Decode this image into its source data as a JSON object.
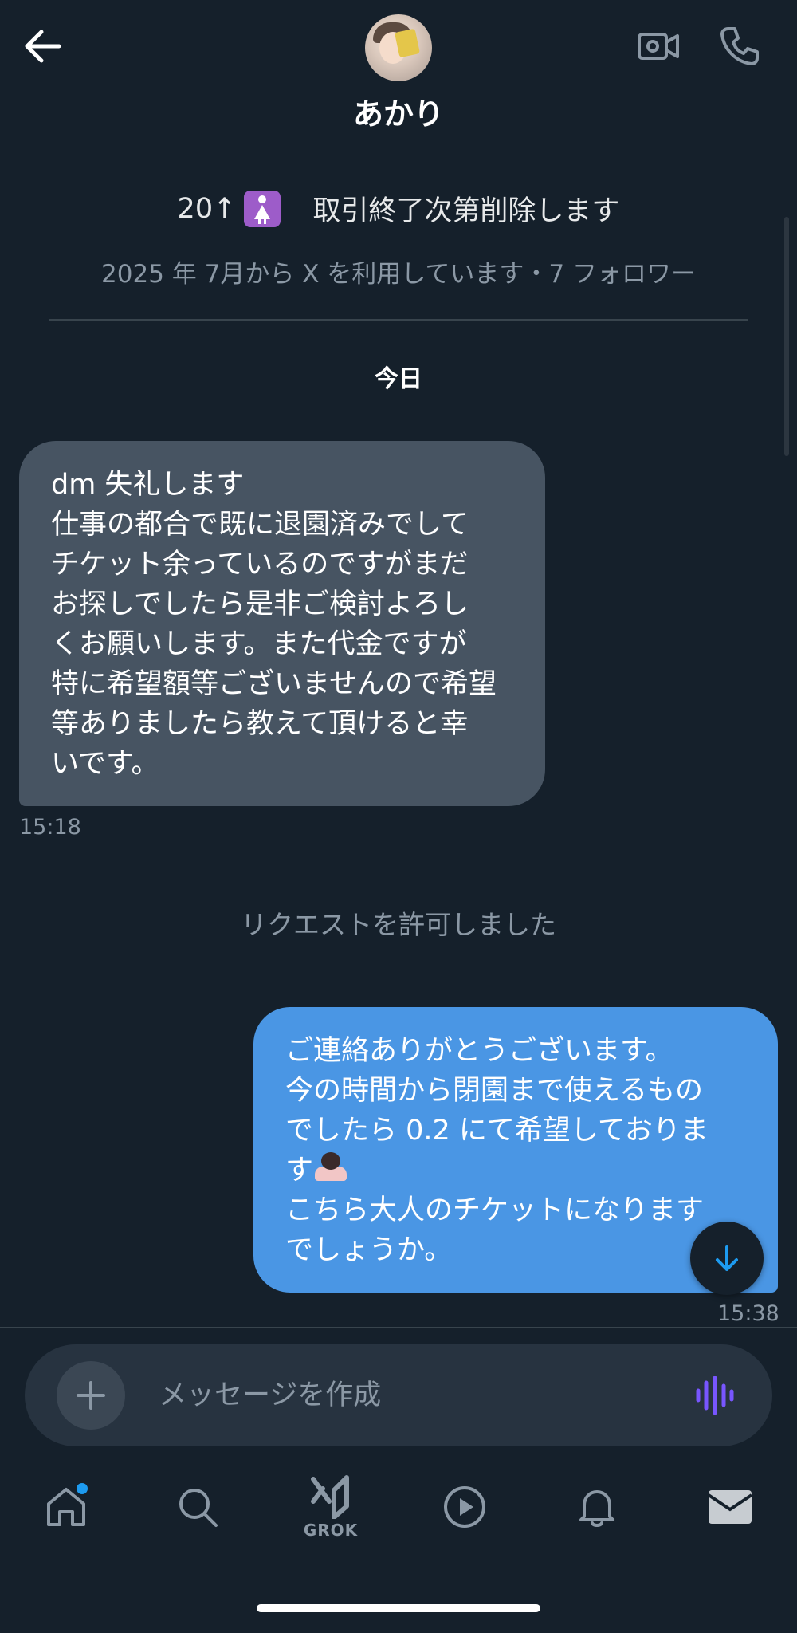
{
  "header": {
    "display_name": "あかり",
    "back_icon": "arrow-left-icon",
    "video_icon": "video-camera-icon",
    "call_icon": "phone-icon"
  },
  "profile": {
    "bio_prefix": "20↑",
    "bio_emoji": "womans-symbol-emoji",
    "bio_text": "取引終了次第削除します",
    "meta": "2025 年 7月から X を利用しています・7 フォロワー"
  },
  "conversation": {
    "date_separator": "今日",
    "incoming": {
      "text": "dm 失礼します\n仕事の都合で既に退園済みでして\nチケット余っているのですがまだ\nお探しでしたら是非ご検討よろし\nくお願いします。また代金ですが\n特に希望額等ございませんので希望\n等ありましたら教えて頂けると幸\nいです。",
      "time": "15:18"
    },
    "system_message": "リクエストを許可しました",
    "outgoing": {
      "text_part1": "ご連絡ありがとうございます。\n今の時間から閉園まで使えるもの\nでしたら 0.2 にて希望しておりま\nす",
      "emoji": "person-bowing-emoji",
      "text_part2": "\nこちら大人のチケットになります\nでしょうか。",
      "time": "15:38"
    }
  },
  "composer": {
    "placeholder": "メッセージを作成",
    "add_icon": "plus-icon",
    "voice_icon": "voice-waveform-icon"
  },
  "bottom_nav": {
    "items": [
      {
        "name": "home",
        "icon": "home-icon",
        "has_notification": true
      },
      {
        "name": "search",
        "icon": "search-icon"
      },
      {
        "name": "grok",
        "icon": "grok-icon",
        "label": "GROK"
      },
      {
        "name": "video",
        "icon": "play-icon"
      },
      {
        "name": "notifications",
        "icon": "bell-icon"
      },
      {
        "name": "messages",
        "icon": "mail-icon",
        "active": true
      }
    ]
  },
  "colors": {
    "background": "#15202b",
    "incoming_bubble": "#475462",
    "outgoing_bubble": "#4a96e4",
    "accent": "#1d9bf0",
    "voice_accent": "#7856ff"
  }
}
